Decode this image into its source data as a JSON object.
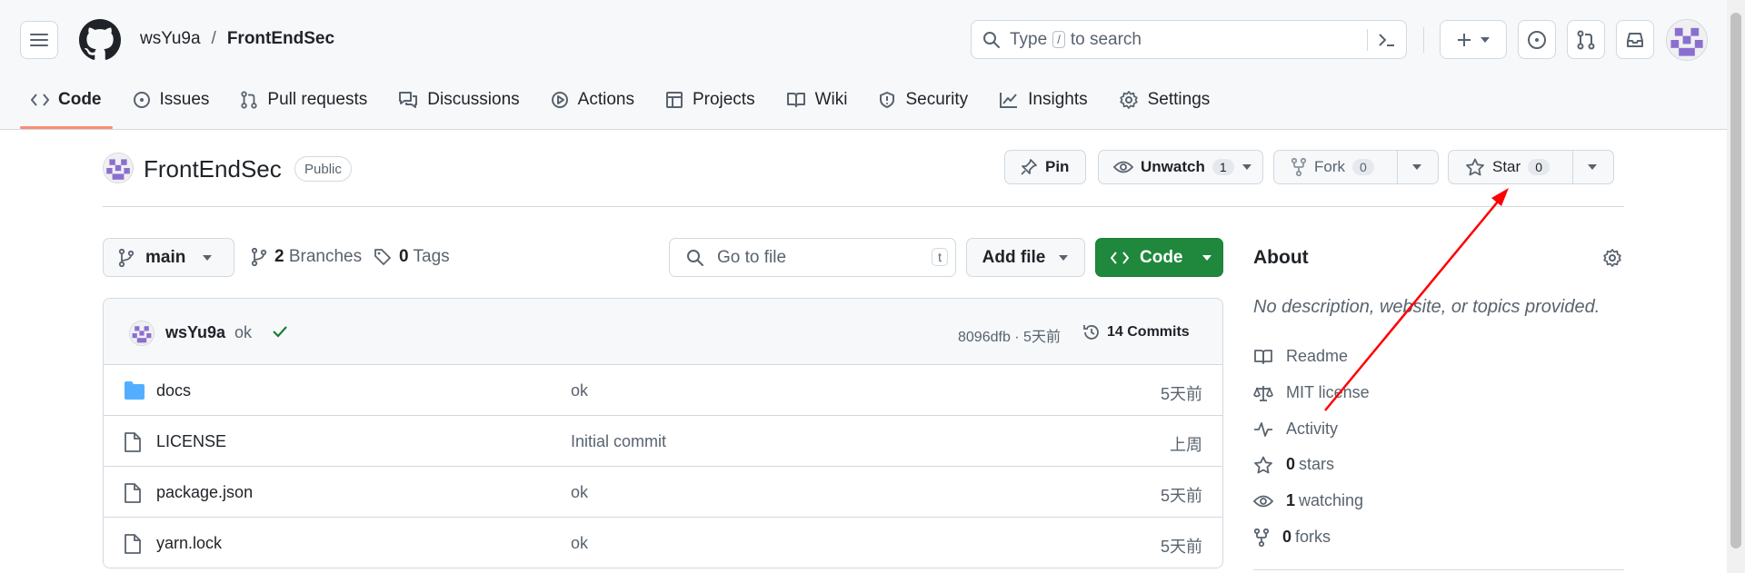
{
  "header": {
    "owner": "wsYu9a",
    "separator": "/",
    "repo": "FrontEndSec",
    "search_placeholder_prefix": "Type",
    "search_slash": "/",
    "search_placeholder_suffix": "to search"
  },
  "tabs": [
    {
      "label": "Code",
      "icon": "code-icon",
      "active": true
    },
    {
      "label": "Issues",
      "icon": "issue-icon"
    },
    {
      "label": "Pull requests",
      "icon": "pull-request-icon"
    },
    {
      "label": "Discussions",
      "icon": "discussion-icon"
    },
    {
      "label": "Actions",
      "icon": "play-icon"
    },
    {
      "label": "Projects",
      "icon": "table-icon"
    },
    {
      "label": "Wiki",
      "icon": "book-icon"
    },
    {
      "label": "Security",
      "icon": "shield-icon"
    },
    {
      "label": "Insights",
      "icon": "graph-icon"
    },
    {
      "label": "Settings",
      "icon": "gear-icon"
    }
  ],
  "repo_title": {
    "name": "FrontEndSec",
    "visibility": "Public",
    "pin_label": "Pin",
    "unwatch_label": "Unwatch",
    "unwatch_count": "1",
    "fork_label": "Fork",
    "fork_count": "0",
    "star_label": "Star",
    "star_count": "0"
  },
  "branch_bar": {
    "branch": "main",
    "branches_count": "2",
    "branches_label": "Branches",
    "tags_count": "0",
    "tags_label": "Tags",
    "goto_placeholder": "Go to file",
    "goto_kbd": "t",
    "add_file_label": "Add file",
    "code_label": "Code"
  },
  "latest_commit": {
    "author": "wsYu9a",
    "message": "ok",
    "hash_time": "8096dfb · 5天前",
    "commits_label": "14 Commits"
  },
  "files": [
    {
      "name": "docs",
      "type": "folder",
      "message": "ok",
      "date": "5天前"
    },
    {
      "name": "LICENSE",
      "type": "file",
      "message": "Initial commit",
      "date": "上周"
    },
    {
      "name": "package.json",
      "type": "file",
      "message": "ok",
      "date": "5天前"
    },
    {
      "name": "yarn.lock",
      "type": "file",
      "message": "ok",
      "date": "5天前"
    }
  ],
  "about": {
    "title": "About",
    "description": "No description, website, or topics provided.",
    "readme": "Readme",
    "license": "MIT license",
    "activity": "Activity",
    "stars_count": "0",
    "stars_label": "stars",
    "watching_count": "1",
    "watching_label": "watching",
    "forks_count": "0",
    "forks_label": "forks"
  },
  "colors": {
    "accent_green": "#1f883d",
    "tab_underline": "#fd8c73",
    "folder_blue": "#54aeff",
    "check_green": "#1a7f37",
    "annotation_red": "#ff0000"
  }
}
